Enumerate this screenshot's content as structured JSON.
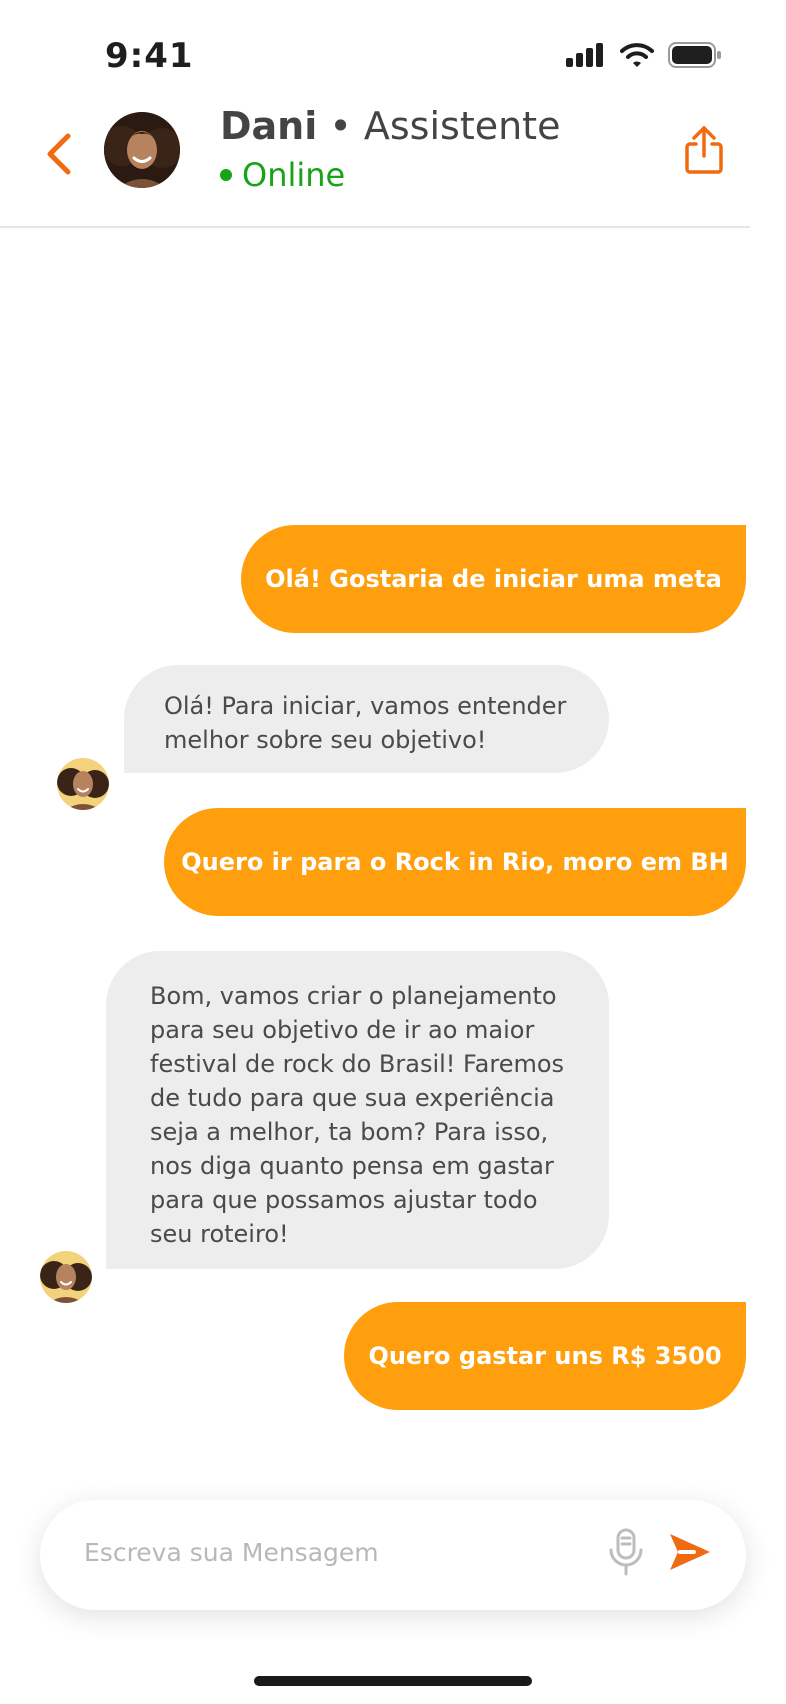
{
  "status_bar": {
    "time": "9:41"
  },
  "header": {
    "name": "Dani",
    "separator": "•",
    "role": "Assistente",
    "status": "Online"
  },
  "messages": [
    {
      "from": "user",
      "text": "Olá! Gostaria de iniciar uma meta"
    },
    {
      "from": "assistant",
      "text": "Olá! Para iniciar, vamos entender melhor sobre seu objetivo!"
    },
    {
      "from": "user",
      "text": "Quero ir para o Rock in Rio, moro em BH"
    },
    {
      "from": "assistant",
      "text": "Bom, vamos criar o planejamento para seu objetivo de ir ao maior festival de rock do Brasil! Faremos de tudo para que sua experiência seja a melhor, ta bom? Para isso, nos diga quanto pensa em gastar para que possamos ajustar todo seu roteiro!"
    },
    {
      "from": "user",
      "text": "Quero gastar uns R$ 3500"
    }
  ],
  "composer": {
    "placeholder": "Escreva sua Mensagem"
  },
  "colors": {
    "accent": "#ff9f0d",
    "icon_accent": "#f26a10",
    "online": "#18a318",
    "incoming_bg": "#ededed"
  },
  "icons": [
    "signal-icon",
    "wifi-icon",
    "battery-icon",
    "chevron-left-icon",
    "share-icon",
    "microphone-icon",
    "send-icon"
  ]
}
